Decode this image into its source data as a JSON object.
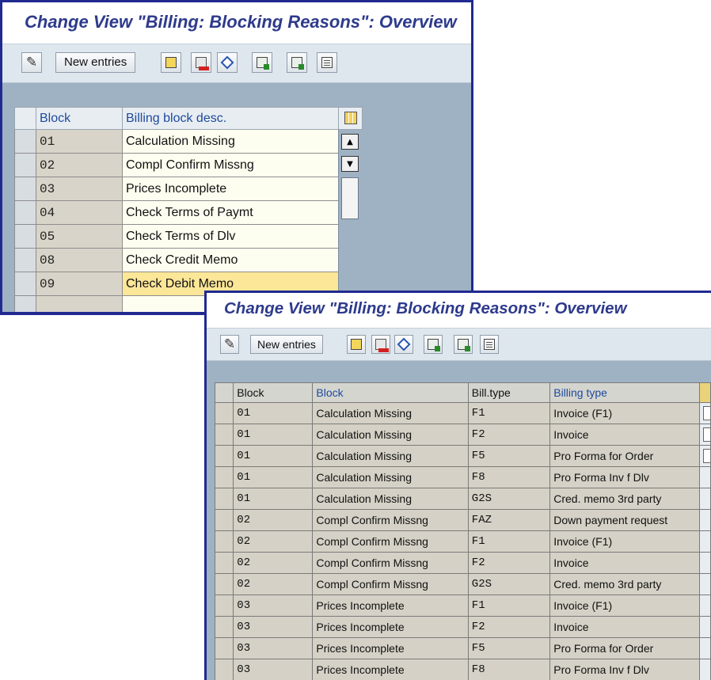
{
  "window1": {
    "title": "Change View \"Billing: Blocking Reasons\": Overview",
    "toolbar": {
      "new_entries": "New entries"
    },
    "table": {
      "headers": [
        "Block",
        "Billing block desc."
      ],
      "rows": [
        {
          "block": "01",
          "desc": "Calculation Missing"
        },
        {
          "block": "02",
          "desc": "Compl Confirm Missng"
        },
        {
          "block": "03",
          "desc": "Prices Incomplete"
        },
        {
          "block": "04",
          "desc": "Check Terms of Paymt"
        },
        {
          "block": "05",
          "desc": "Check Terms of Dlv"
        },
        {
          "block": "08",
          "desc": "Check Credit Memo"
        },
        {
          "block": "09",
          "desc": "Check Debit Memo"
        }
      ]
    }
  },
  "window2": {
    "title": "Change View \"Billing: Blocking Reasons\": Overview",
    "toolbar": {
      "new_entries": "New entries"
    },
    "table": {
      "headers": [
        "Block",
        "Block",
        "Bill.type",
        "Billing type"
      ],
      "rows": [
        {
          "block": "01",
          "desc": "Calculation Missing",
          "bill_type": "F1",
          "billing_type": "Invoice (F1)"
        },
        {
          "block": "01",
          "desc": "Calculation Missing",
          "bill_type": "F2",
          "billing_type": "Invoice"
        },
        {
          "block": "01",
          "desc": "Calculation Missing",
          "bill_type": "F5",
          "billing_type": "Pro Forma for Order"
        },
        {
          "block": "01",
          "desc": "Calculation Missing",
          "bill_type": "F8",
          "billing_type": "Pro Forma Inv f Dlv"
        },
        {
          "block": "01",
          "desc": "Calculation Missing",
          "bill_type": "G2S",
          "billing_type": "Cred. memo 3rd party"
        },
        {
          "block": "02",
          "desc": "Compl Confirm Missng",
          "bill_type": "FAZ",
          "billing_type": "Down payment request"
        },
        {
          "block": "02",
          "desc": "Compl Confirm Missng",
          "bill_type": "F1",
          "billing_type": "Invoice (F1)"
        },
        {
          "block": "02",
          "desc": "Compl Confirm Missng",
          "bill_type": "F2",
          "billing_type": "Invoice"
        },
        {
          "block": "02",
          "desc": "Compl Confirm Missng",
          "bill_type": "G2S",
          "billing_type": "Cred. memo 3rd party"
        },
        {
          "block": "03",
          "desc": "Prices Incomplete",
          "bill_type": "F1",
          "billing_type": "Invoice (F1)"
        },
        {
          "block": "03",
          "desc": "Prices Incomplete",
          "bill_type": "F2",
          "billing_type": "Invoice"
        },
        {
          "block": "03",
          "desc": "Prices Incomplete",
          "bill_type": "F5",
          "billing_type": "Pro Forma for Order"
        },
        {
          "block": "03",
          "desc": "Prices Incomplete",
          "bill_type": "F8",
          "billing_type": "Pro Forma Inv f Dlv"
        }
      ]
    }
  }
}
